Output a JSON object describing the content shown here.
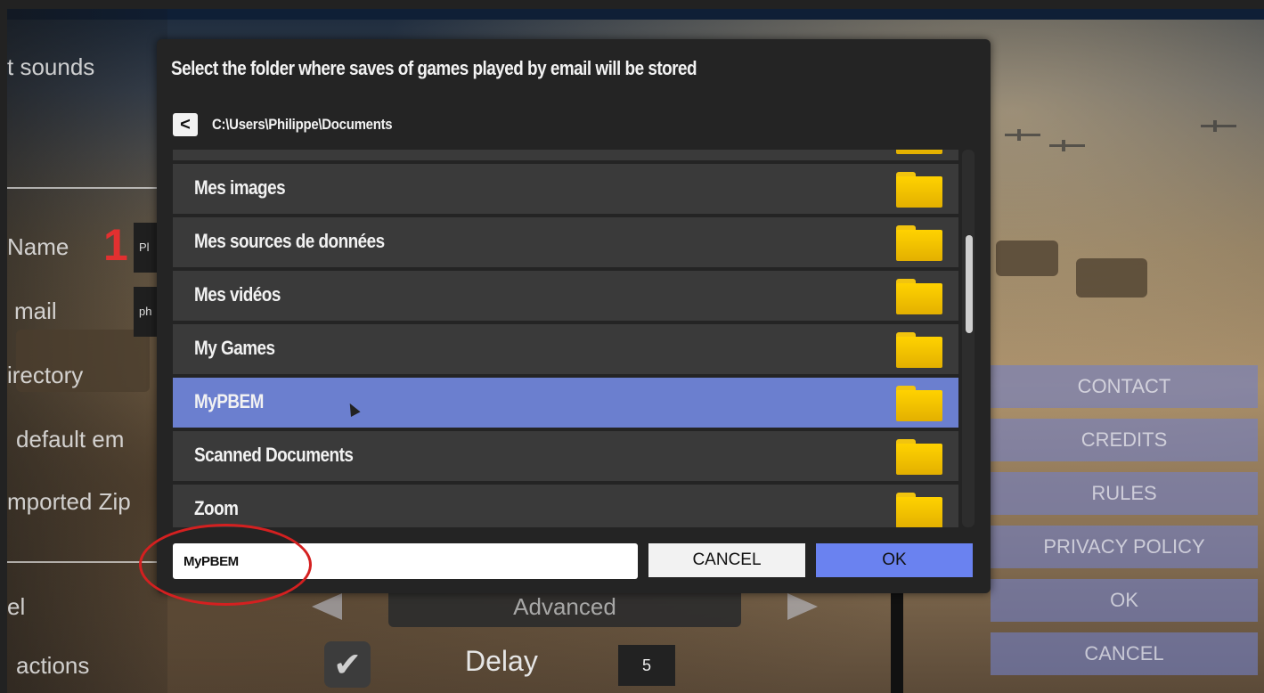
{
  "background": {
    "menu_labels": [
      "t sounds",
      "Name",
      "mail",
      "irectory",
      "default em",
      "mported Zip",
      "el",
      "actions"
    ],
    "step_marker": "1",
    "name_field_value": "Pl",
    "email_field_value": "ph",
    "advanced_label": "Advanced",
    "delay_label": "Delay",
    "delay_value": "5",
    "side_buttons": [
      "CONTACT",
      "CREDITS",
      "RULES",
      "PRIVACY POLICY",
      "OK",
      "CANCEL"
    ]
  },
  "dialog": {
    "title": "Select the folder where saves of games played by email will be stored",
    "back_label": "<",
    "current_path": "C:\\Users\\Philippe\\Documents",
    "folders": [
      {
        "label": "",
        "selected": false
      },
      {
        "label": "Mes images",
        "selected": false
      },
      {
        "label": "Mes sources de données",
        "selected": false
      },
      {
        "label": "Mes vidéos",
        "selected": false
      },
      {
        "label": "My Games",
        "selected": false
      },
      {
        "label": "MyPBEM",
        "selected": true
      },
      {
        "label": "Scanned Documents",
        "selected": false
      },
      {
        "label": "Zoom",
        "selected": false
      }
    ],
    "folder_name_value": "MyPBEM",
    "cancel_label": "CANCEL",
    "ok_label": "OK"
  },
  "colors": {
    "selected_row": "#6b7fcf",
    "ok_button": "#6a82f0",
    "folder_icon": "#ffd200",
    "highlight_ring": "#d42020"
  }
}
